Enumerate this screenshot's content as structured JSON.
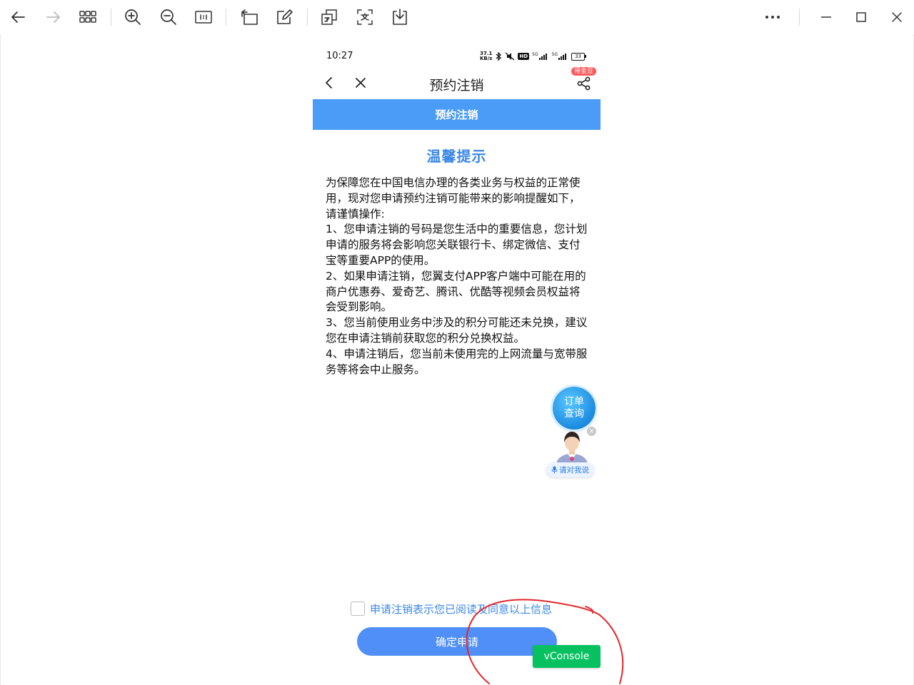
{
  "viewer": {
    "toolbar_icons": [
      "back-arrow",
      "forward-arrow",
      "grid-view",
      "zoom-in",
      "zoom-out",
      "actual-size",
      "rotate",
      "edit",
      "translate",
      "ocr",
      "save-download",
      "more",
      "minimize",
      "maximize",
      "close"
    ]
  },
  "phone": {
    "status": {
      "time": "10:27",
      "speed_value": "37.1",
      "speed_unit": "KB/s",
      "hd_label": "HD",
      "battery": "33",
      "net1": "5G",
      "net2": "5G"
    },
    "nav": {
      "title": "预约注销",
      "badge": "得金豆"
    },
    "banner_title": "预约注销",
    "tip_title": "温馨提示",
    "notice": [
      "为保障您在中国电信办理的各类业务与权益的正常使用，现对您申请预约注销可能带来的影响提醒如下，请谨慎操作:",
      "1、您申请注销的号码是您生活中的重要信息，您计划申请的服务将会影响您关联银行卡、绑定微信、支付宝等重要APP的使用。",
      "2、如果申请注销，您翼支付APP客户端中可能在用的商户优惠券、爱奇艺、腾讯、优酷等视频会员权益将会受到影响。",
      "3、您当前使用业务中涉及的积分可能还未兑换，建议您在申请注销前获取您的积分兑换权益。",
      "4、申请注销后，您当前未使用完的上网流量与宽带服务等将会中止服务。"
    ],
    "order_bubble": "订单查询",
    "talk_label": "请对我说",
    "agree_text": "申请注销表示您已阅读及同意以上信息",
    "agree_checked": false,
    "confirm_label": "确定申请",
    "vconsole_label": "vConsole"
  },
  "colors": {
    "banner": "#4a9cf6",
    "accent_text": "#3b87e6",
    "confirm_button": "#4f8ff7",
    "vconsole": "#07c160",
    "annotation": "#e3262b"
  }
}
